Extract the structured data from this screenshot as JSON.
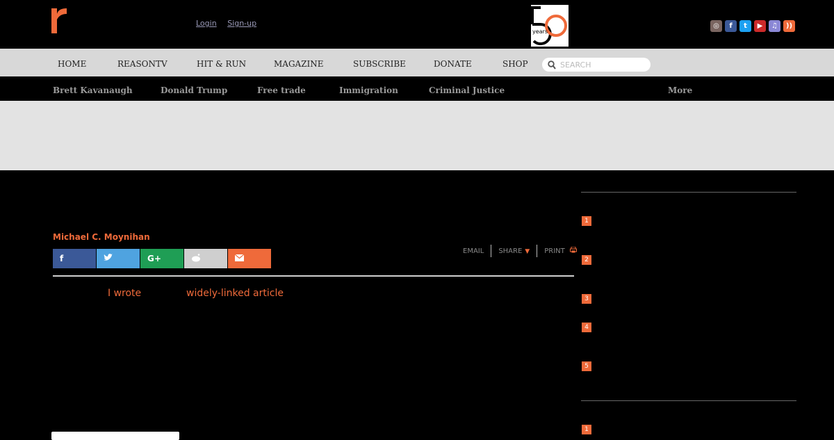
{
  "header": {
    "logo_letter": "r",
    "login_label": "Login",
    "signup_label": "Sign-up",
    "anniversary_text": "years"
  },
  "socials": [
    {
      "name": "instagram-icon",
      "glyph": "◎",
      "color": "#7a6560"
    },
    {
      "name": "facebook-icon",
      "glyph": "f",
      "color": "#3b5998"
    },
    {
      "name": "twitter-icon",
      "glyph": "t",
      "color": "#1da1f2"
    },
    {
      "name": "youtube-icon",
      "glyph": "▶",
      "color": "#cc2a2a"
    },
    {
      "name": "itunes-icon",
      "glyph": "♫",
      "color": "#8b88d6"
    },
    {
      "name": "rss-icon",
      "glyph": "))",
      "color": "#ef6a3a"
    }
  ],
  "nav": {
    "items": [
      "HOME",
      "REASONTV",
      "HIT & RUN",
      "MAGAZINE",
      "SUBSCRIBE",
      "DONATE",
      "SHOP"
    ],
    "search_placeholder": "SEARCH"
  },
  "topics": [
    "Brett Kavanaugh",
    "Donald Trump",
    "Free trade",
    "Immigration",
    "Criminal Justice",
    "More"
  ],
  "article": {
    "author": "Michael C. Moynihan",
    "tools": {
      "email": "EMAIL",
      "share": "SHARE",
      "print": "PRINT"
    },
    "link1": "I wrote",
    "link2": "widely-linked article"
  },
  "sidebar": {
    "list1": [
      "1",
      "2",
      "3",
      "4",
      "5"
    ],
    "list2": [
      "1"
    ]
  },
  "colors": {
    "accent": "#ef6a3a"
  }
}
